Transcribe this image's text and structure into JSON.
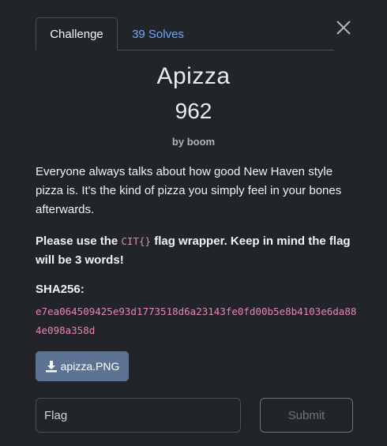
{
  "tabs": {
    "challenge_label": "Challenge",
    "solves_label": "39 Solves"
  },
  "challenge": {
    "name": "Apizza",
    "value": "962",
    "author": "by boom",
    "description_1": "Everyone always talks about how good New Haven style pizza is. It's the kind of pizza you simply feel in your bones afterwards.",
    "description_2_pre": "Please use the ",
    "description_2_code": "CIT{}",
    "description_2_post": " flag wrapper. Keep in mind the flag will be 3 words!",
    "sha_label": "SHA256:",
    "sha_value": "e7ea064509425e93d1773518d6a23143fe0fd00b5e8b4103e6da884e098a358d"
  },
  "download": {
    "label": "apizza.PNG",
    "icon": "download-icon"
  },
  "form": {
    "flag_placeholder": "Flag",
    "flag_value": "",
    "submit_label": "Submit"
  },
  "icons": {
    "close": "close-icon"
  },
  "colors": {
    "background": "#212529",
    "link": "#6ea8fe",
    "code": "#e685b5",
    "download_button": "#5c7394"
  }
}
